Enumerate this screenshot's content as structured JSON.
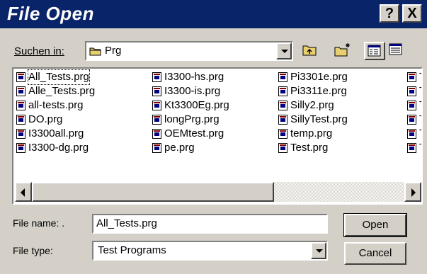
{
  "window": {
    "title": "File Open",
    "help_label": "?",
    "close_label": "X"
  },
  "lookin": {
    "label": "Suchen in:",
    "value": "Prg"
  },
  "files": {
    "col1": [
      "All_Tests.prg",
      "Alle_Tests.prg",
      "all-tests.prg",
      "DO.prg",
      "I3300all.prg",
      "I3300-dg.prg"
    ],
    "col2": [
      "I3300-hs.prg",
      "I3300-is.prg",
      "Kt3300Eg.prg",
      "longPrg.prg",
      "OEMtest.prg",
      "pe.prg"
    ],
    "col3": [
      "Pi3301e.prg",
      "Pi3311e.prg",
      "Silly2.prg",
      "SillyTest.prg",
      "temp.prg",
      "Test.prg"
    ],
    "col4": [
      "T",
      "T",
      "T",
      "T",
      "T",
      "T"
    ]
  },
  "filename": {
    "label": "File name: .",
    "value": "All_Tests.prg"
  },
  "filetype": {
    "label": "File type:",
    "value": "Test Programs"
  },
  "buttons": {
    "open": "Open",
    "cancel": "Cancel"
  }
}
